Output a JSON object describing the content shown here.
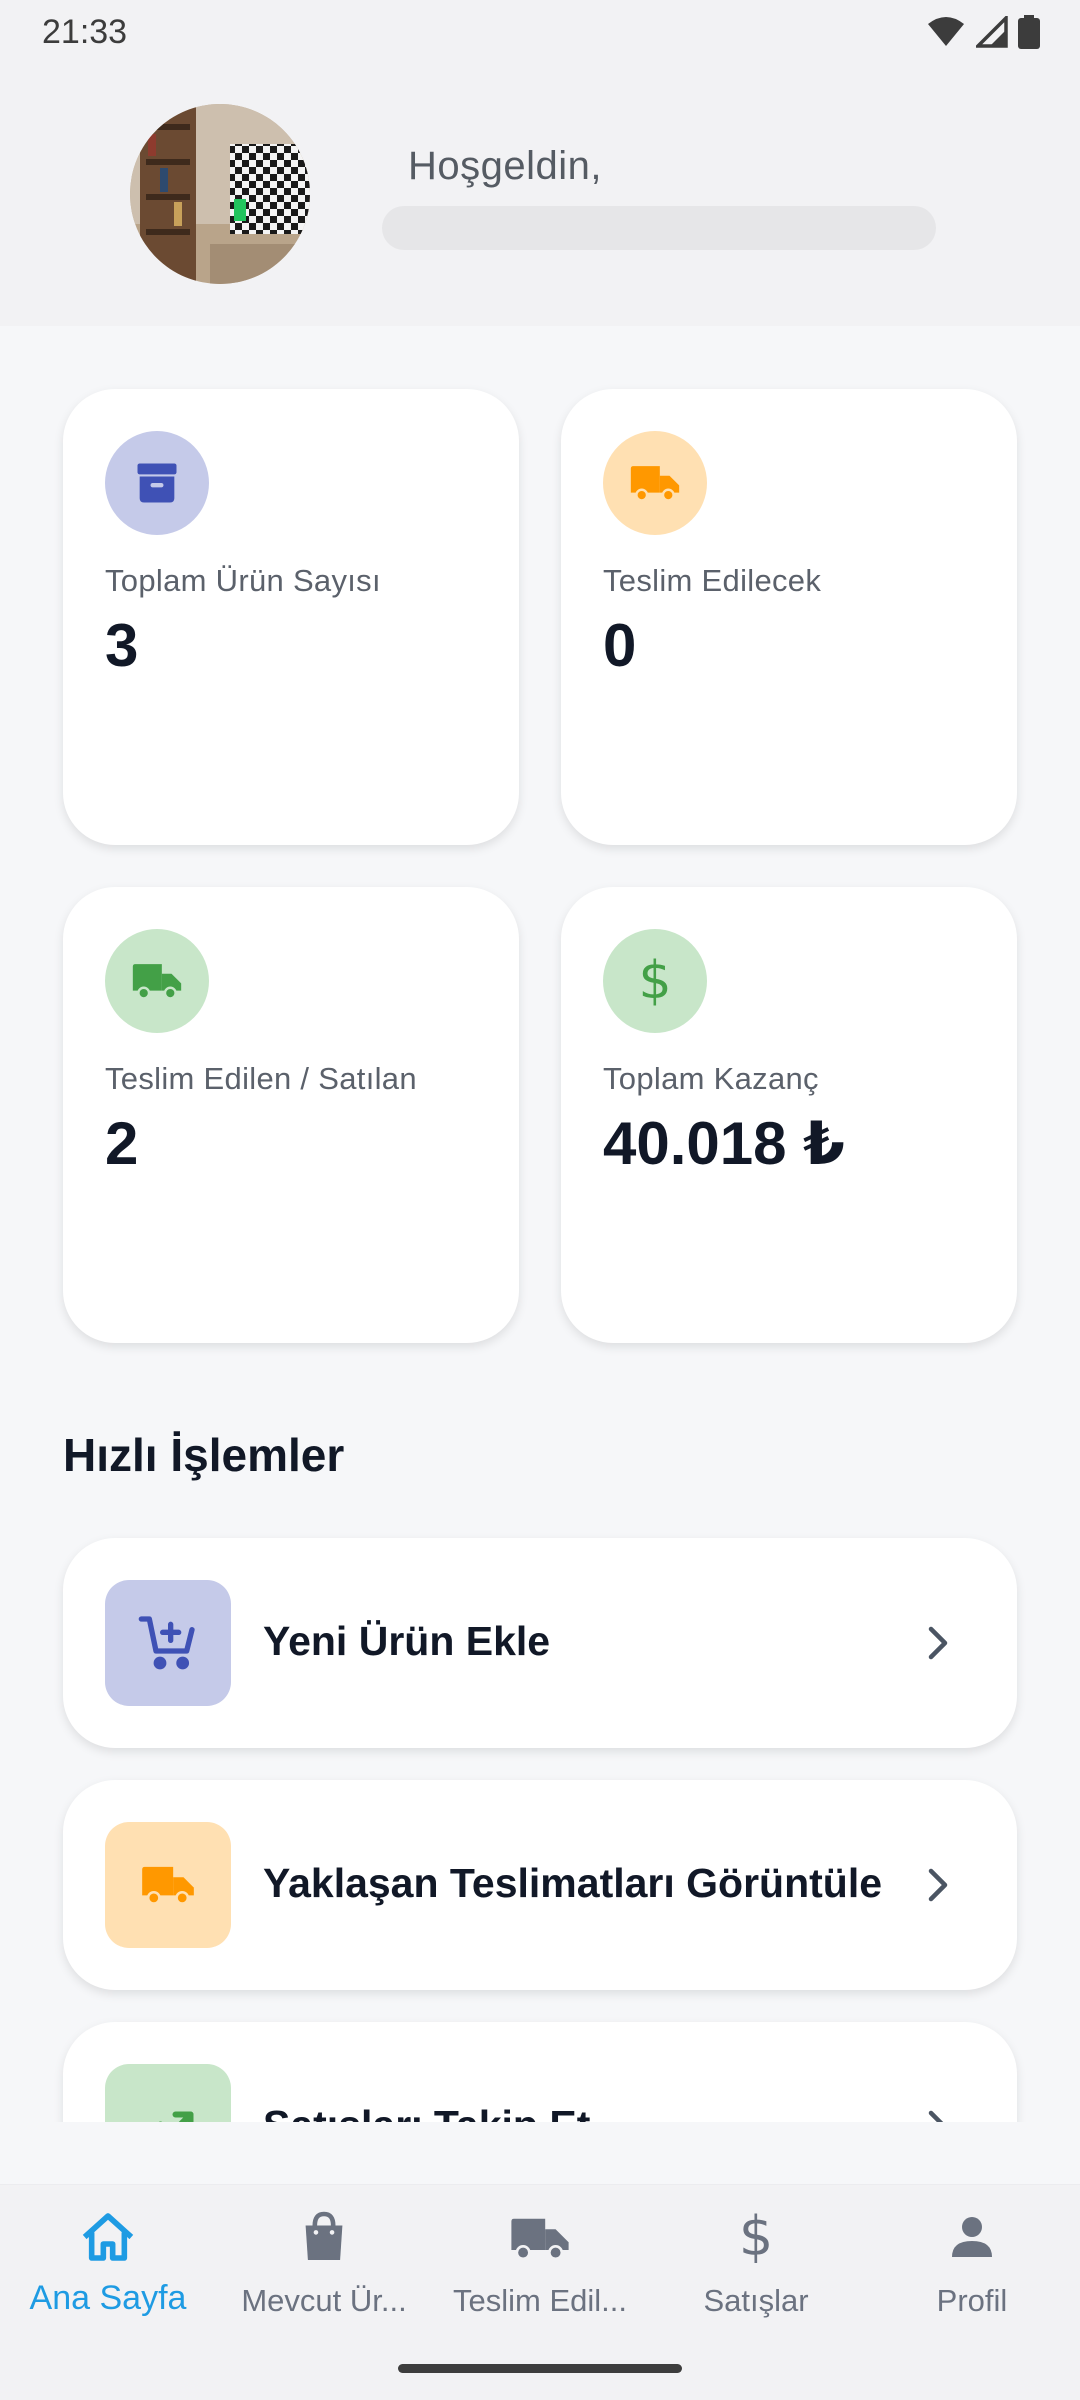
{
  "status_bar": {
    "time": "21:33"
  },
  "header": {
    "welcome": "Hoşgeldin,"
  },
  "stats": [
    {
      "label": "Toplam Ürün Sayısı",
      "value": "3",
      "icon": "archive-box-icon",
      "color": "#3f51b5",
      "bg": "#c5cae9"
    },
    {
      "label": "Teslim Edilecek",
      "value": "0",
      "icon": "truck-icon",
      "color": "#ff9800",
      "bg": "#ffe0b2"
    },
    {
      "label": "Teslim Edilen / Satılan",
      "value": "2",
      "icon": "truck-icon",
      "color": "#43a047",
      "bg": "#c8e6c9"
    },
    {
      "label": "Toplam Kazanç",
      "value": "40.018 ₺",
      "icon": "dollar-icon",
      "color": "#43a047",
      "bg": "#c8e6c9"
    }
  ],
  "quick_actions": {
    "title": "Hızlı İşlemler",
    "items": [
      {
        "label": "Yeni Ürün Ekle",
        "icon": "add-cart-icon"
      },
      {
        "label": "Yaklaşan Teslimatları Görüntüle",
        "icon": "truck-icon"
      },
      {
        "label": "Satışları Takip Et",
        "icon": "trending-up-icon"
      }
    ]
  },
  "bottom_nav": {
    "items": [
      {
        "label": "Ana Sayfa",
        "icon": "home-icon",
        "active": true
      },
      {
        "label": "Mevcut Ür...",
        "icon": "shopping-bag-icon"
      },
      {
        "label": "Teslim Edil...",
        "icon": "truck-icon"
      },
      {
        "label": "Satışlar",
        "icon": "dollar-icon"
      },
      {
        "label": "Profil",
        "icon": "person-icon"
      }
    ],
    "active_color": "#1e9be3"
  }
}
